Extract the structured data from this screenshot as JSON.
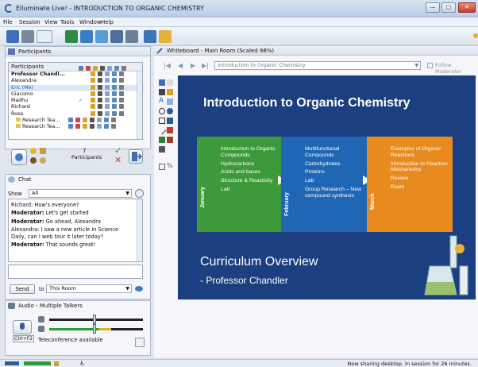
{
  "window": {
    "title": "Elluminate Live! - INTRODUCTION TO ORGANIC CHEMISTRY",
    "minimize_label": "—",
    "maximize_label": "▢",
    "close_label": "✕"
  },
  "menu": [
    "File",
    "Session",
    "View",
    "Tools",
    "Window",
    "Help"
  ],
  "toolbar_icons": [
    "save-icon",
    "print-icon",
    "layout-icon",
    "desktop-share-icon",
    "app-share-icon",
    "whiteboard-icon",
    "video-icon",
    "camera-icon",
    "folder-icon",
    "notes-icon"
  ],
  "participants": {
    "title": "Participants",
    "header": "Participants",
    "rows": [
      {
        "name": "Professor Chandl...",
        "style": "bold"
      },
      {
        "name": "Alexandra",
        "style": ""
      },
      {
        "name": "Eric (Me)",
        "style": "blue"
      },
      {
        "name": "Giacomo",
        "style": ""
      },
      {
        "name": "Madhu",
        "style": "",
        "check": "✓"
      },
      {
        "name": "Richard",
        "style": ""
      },
      {
        "name": "Rosa",
        "style": ""
      },
      {
        "name": "Research Tea...",
        "style": "group"
      },
      {
        "name": "Research Tea...",
        "style": "group"
      }
    ],
    "count": "7",
    "count_label": "Participants"
  },
  "chat": {
    "title": "Chat",
    "show_label": "Show",
    "show_value": "All",
    "messages": [
      {
        "sender": "Richard:",
        "text": "How's everyone?",
        "bold": false
      },
      {
        "sender": "Moderator:",
        "text": "Let's get started",
        "bold": true
      },
      {
        "sender": "Moderator:",
        "text": "Go ahead, Alexandra",
        "bold": true
      },
      {
        "sender": "Alexandra:",
        "text": "I saw a new article in Science Daily, can I web tour it later today?",
        "bold": false
      },
      {
        "sender": "Moderator:",
        "text": "That sounds great!",
        "bold": true
      }
    ],
    "send_label": "Send",
    "to_label": "to",
    "to_value": "This Room"
  },
  "audio": {
    "title": "Audio - Multiple Talkers",
    "key_label": "Ctrl+F2",
    "status": "Teleconference available"
  },
  "whiteboard": {
    "title": "Whiteboard - Main Room (Scaled 98%)",
    "page_value": "Introduction to Organic Chemistry",
    "follow_label": "Follow Moderator",
    "slide": {
      "title": "Introduction to Organic Chemistry",
      "blocks": [
        {
          "month": "January",
          "color": "#3d9a3a",
          "items": [
            "Introduction to Organic Compounds",
            "Hydrocarbons",
            "Acids and bases",
            "Structure & Reactivity",
            "Lab"
          ]
        },
        {
          "month": "February",
          "color": "#1f66b5",
          "items": [
            "Multifunctional Compounds",
            "Carbohydrates",
            "Proteins",
            "Lab",
            "Group Research – New compound synthesis"
          ]
        },
        {
          "month": "March",
          "color": "#e98a1e",
          "items": [
            "Examples of Organic Reactions",
            "Introduction to Reaction Mechanisms",
            "Review",
            "Exam"
          ]
        }
      ],
      "subtitle1": "Curriculum Overview",
      "subtitle2": "- Professor Chandler"
    }
  },
  "status": {
    "text": "Now sharing desktop.  In session for 26 minutes."
  },
  "colors": {
    "slide_bg": "#1b3f80",
    "green": "#3d9a3a",
    "blue": "#1f66b5",
    "orange": "#e98a1e"
  }
}
